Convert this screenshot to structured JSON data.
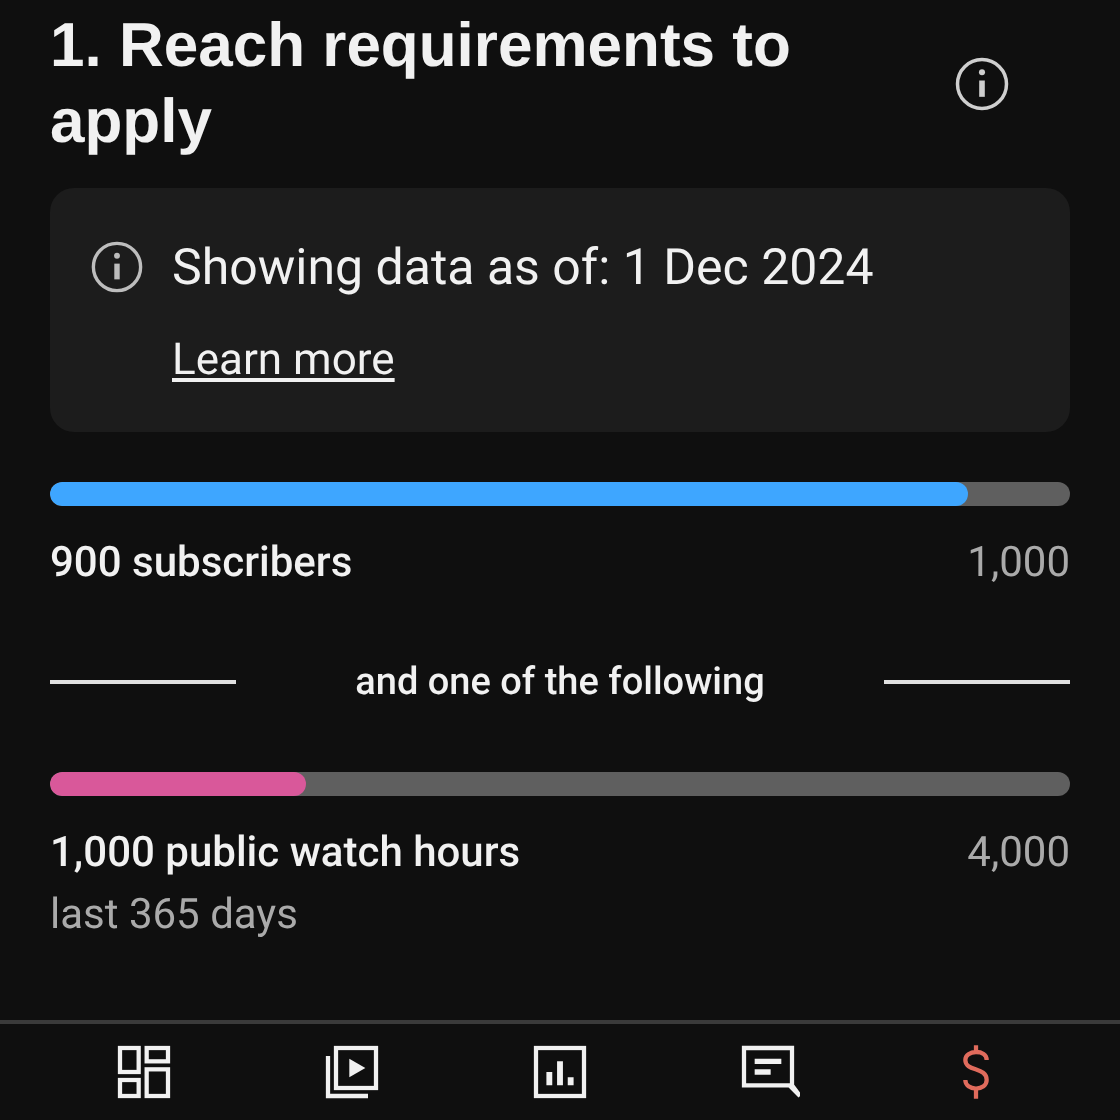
{
  "title": "1. Reach requirements to apply",
  "notice": {
    "text": "Showing data as of: 1 Dec 2024",
    "link": "Learn more"
  },
  "requirements": [
    {
      "kind": "progress",
      "level": 0.9,
      "color": "#3ea6ff",
      "label": "900 subscribers",
      "target": "1,000"
    },
    {
      "kind": "divider",
      "label": "and one of the following"
    },
    {
      "kind": "progress",
      "level": 0.25,
      "color": "#d9589a",
      "label": "1,000 public watch hours",
      "target": "4,000",
      "sublabel": "last 365 days"
    }
  ],
  "nav": [
    {
      "kind": "dashboard",
      "selected": false
    },
    {
      "kind": "content",
      "selected": false
    },
    {
      "kind": "analytics",
      "selected": false
    },
    {
      "kind": "comments",
      "selected": false
    },
    {
      "kind": "earn",
      "selected": true
    }
  ]
}
